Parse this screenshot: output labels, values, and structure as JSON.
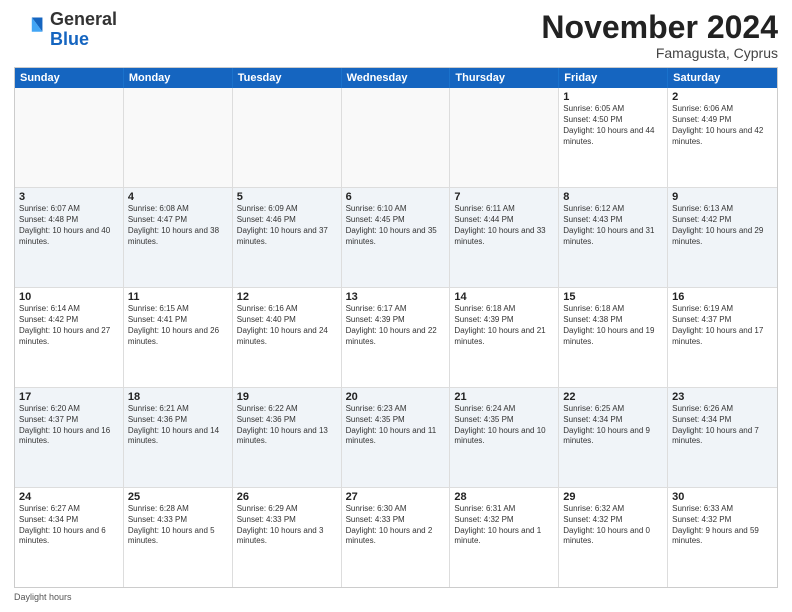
{
  "logo": {
    "general": "General",
    "blue": "Blue"
  },
  "title": "November 2024",
  "subtitle": "Famagusta, Cyprus",
  "days": [
    "Sunday",
    "Monday",
    "Tuesday",
    "Wednesday",
    "Thursday",
    "Friday",
    "Saturday"
  ],
  "footer": "Daylight hours",
  "weeks": [
    [
      {
        "day": "",
        "text": ""
      },
      {
        "day": "",
        "text": ""
      },
      {
        "day": "",
        "text": ""
      },
      {
        "day": "",
        "text": ""
      },
      {
        "day": "",
        "text": ""
      },
      {
        "day": "1",
        "text": "Sunrise: 6:05 AM\nSunset: 4:50 PM\nDaylight: 10 hours and 44 minutes."
      },
      {
        "day": "2",
        "text": "Sunrise: 6:06 AM\nSunset: 4:49 PM\nDaylight: 10 hours and 42 minutes."
      }
    ],
    [
      {
        "day": "3",
        "text": "Sunrise: 6:07 AM\nSunset: 4:48 PM\nDaylight: 10 hours and 40 minutes."
      },
      {
        "day": "4",
        "text": "Sunrise: 6:08 AM\nSunset: 4:47 PM\nDaylight: 10 hours and 38 minutes."
      },
      {
        "day": "5",
        "text": "Sunrise: 6:09 AM\nSunset: 4:46 PM\nDaylight: 10 hours and 37 minutes."
      },
      {
        "day": "6",
        "text": "Sunrise: 6:10 AM\nSunset: 4:45 PM\nDaylight: 10 hours and 35 minutes."
      },
      {
        "day": "7",
        "text": "Sunrise: 6:11 AM\nSunset: 4:44 PM\nDaylight: 10 hours and 33 minutes."
      },
      {
        "day": "8",
        "text": "Sunrise: 6:12 AM\nSunset: 4:43 PM\nDaylight: 10 hours and 31 minutes."
      },
      {
        "day": "9",
        "text": "Sunrise: 6:13 AM\nSunset: 4:42 PM\nDaylight: 10 hours and 29 minutes."
      }
    ],
    [
      {
        "day": "10",
        "text": "Sunrise: 6:14 AM\nSunset: 4:42 PM\nDaylight: 10 hours and 27 minutes."
      },
      {
        "day": "11",
        "text": "Sunrise: 6:15 AM\nSunset: 4:41 PM\nDaylight: 10 hours and 26 minutes."
      },
      {
        "day": "12",
        "text": "Sunrise: 6:16 AM\nSunset: 4:40 PM\nDaylight: 10 hours and 24 minutes."
      },
      {
        "day": "13",
        "text": "Sunrise: 6:17 AM\nSunset: 4:39 PM\nDaylight: 10 hours and 22 minutes."
      },
      {
        "day": "14",
        "text": "Sunrise: 6:18 AM\nSunset: 4:39 PM\nDaylight: 10 hours and 21 minutes."
      },
      {
        "day": "15",
        "text": "Sunrise: 6:18 AM\nSunset: 4:38 PM\nDaylight: 10 hours and 19 minutes."
      },
      {
        "day": "16",
        "text": "Sunrise: 6:19 AM\nSunset: 4:37 PM\nDaylight: 10 hours and 17 minutes."
      }
    ],
    [
      {
        "day": "17",
        "text": "Sunrise: 6:20 AM\nSunset: 4:37 PM\nDaylight: 10 hours and 16 minutes."
      },
      {
        "day": "18",
        "text": "Sunrise: 6:21 AM\nSunset: 4:36 PM\nDaylight: 10 hours and 14 minutes."
      },
      {
        "day": "19",
        "text": "Sunrise: 6:22 AM\nSunset: 4:36 PM\nDaylight: 10 hours and 13 minutes."
      },
      {
        "day": "20",
        "text": "Sunrise: 6:23 AM\nSunset: 4:35 PM\nDaylight: 10 hours and 11 minutes."
      },
      {
        "day": "21",
        "text": "Sunrise: 6:24 AM\nSunset: 4:35 PM\nDaylight: 10 hours and 10 minutes."
      },
      {
        "day": "22",
        "text": "Sunrise: 6:25 AM\nSunset: 4:34 PM\nDaylight: 10 hours and 9 minutes."
      },
      {
        "day": "23",
        "text": "Sunrise: 6:26 AM\nSunset: 4:34 PM\nDaylight: 10 hours and 7 minutes."
      }
    ],
    [
      {
        "day": "24",
        "text": "Sunrise: 6:27 AM\nSunset: 4:34 PM\nDaylight: 10 hours and 6 minutes."
      },
      {
        "day": "25",
        "text": "Sunrise: 6:28 AM\nSunset: 4:33 PM\nDaylight: 10 hours and 5 minutes."
      },
      {
        "day": "26",
        "text": "Sunrise: 6:29 AM\nSunset: 4:33 PM\nDaylight: 10 hours and 3 minutes."
      },
      {
        "day": "27",
        "text": "Sunrise: 6:30 AM\nSunset: 4:33 PM\nDaylight: 10 hours and 2 minutes."
      },
      {
        "day": "28",
        "text": "Sunrise: 6:31 AM\nSunset: 4:32 PM\nDaylight: 10 hours and 1 minute."
      },
      {
        "day": "29",
        "text": "Sunrise: 6:32 AM\nSunset: 4:32 PM\nDaylight: 10 hours and 0 minutes."
      },
      {
        "day": "30",
        "text": "Sunrise: 6:33 AM\nSunset: 4:32 PM\nDaylight: 9 hours and 59 minutes."
      }
    ]
  ]
}
